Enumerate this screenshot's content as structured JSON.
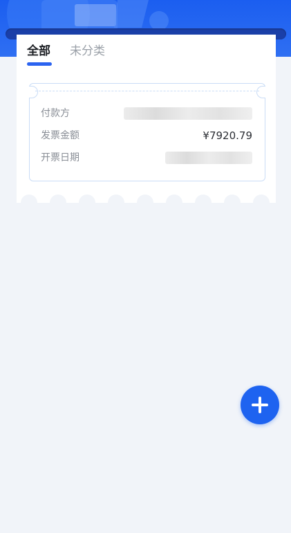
{
  "tabs": [
    {
      "label": "全部",
      "active": true
    },
    {
      "label": "未分类",
      "active": false
    }
  ],
  "invoice": {
    "payer_label": "付款方",
    "amount_label": "发票金额",
    "amount_value": "¥7920.79",
    "date_label": "开票日期"
  },
  "colors": {
    "primary": "#1e63f0",
    "header": "#1b5ef0",
    "background": "#f1f4f9",
    "ticket_border": "#c9dcf6"
  },
  "icons": {
    "fab": "plus-icon"
  }
}
